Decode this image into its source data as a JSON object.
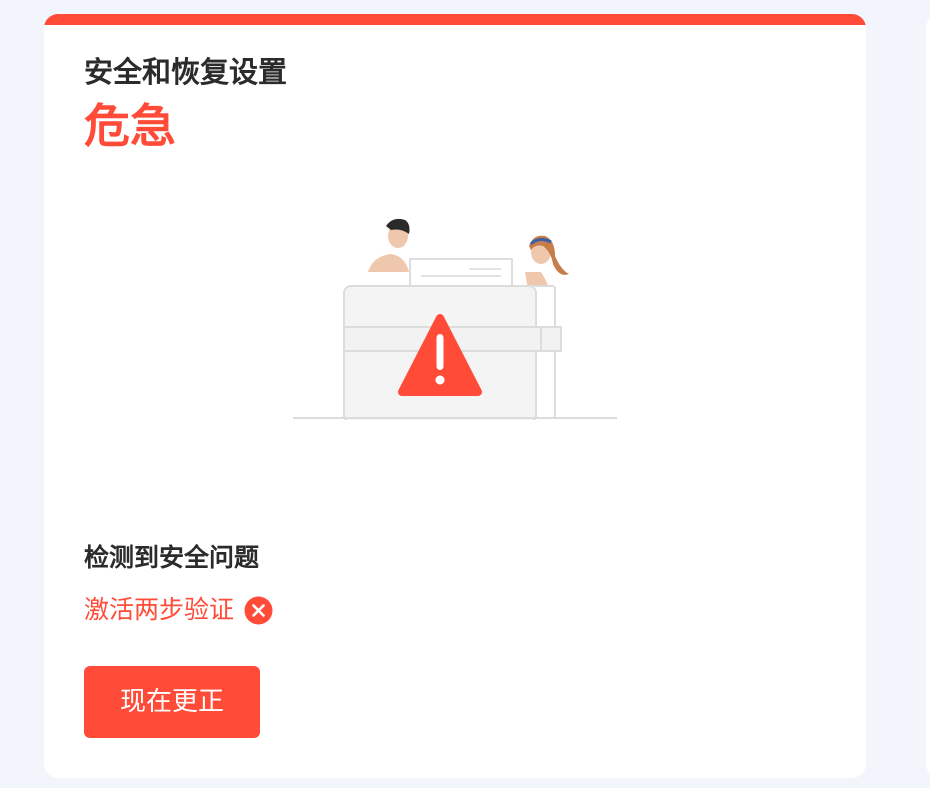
{
  "card": {
    "title": "安全和恢复设置",
    "status": "危急",
    "issues_heading": "检测到安全问题",
    "issues": [
      {
        "label": "激活两步验证",
        "icon": "close-circle-icon"
      }
    ],
    "fix_button_label": "现在更正"
  },
  "colors": {
    "accent": "#ff4b38",
    "page_background": "#f2f5fc",
    "card_background": "#ffffff",
    "heading_text": "#2b2b2b"
  },
  "illustration": {
    "icon": "warning-triangle-icon"
  }
}
